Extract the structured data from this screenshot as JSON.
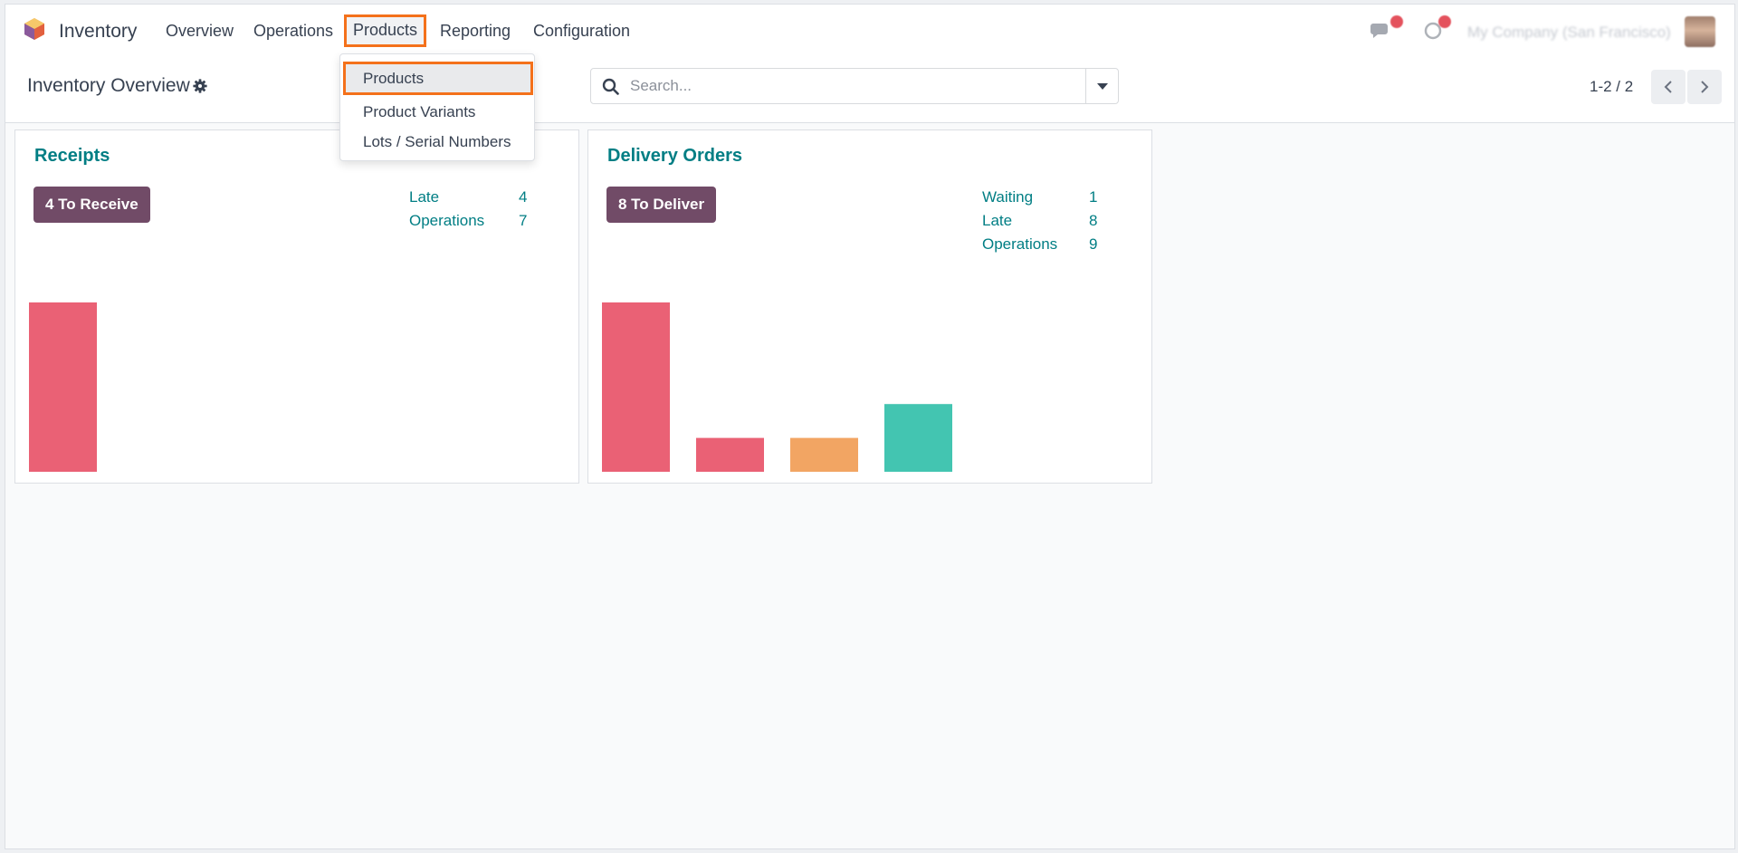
{
  "app": {
    "name": "Inventory"
  },
  "menu": {
    "items": [
      "Overview",
      "Operations",
      "Products",
      "Reporting",
      "Configuration"
    ]
  },
  "products_dropdown": {
    "items": [
      "Products",
      "Product Variants",
      "Lots / Serial Numbers"
    ]
  },
  "systray": {
    "company": "My Company (San Francisco)"
  },
  "control_panel": {
    "breadcrumb": "Inventory Overview",
    "search_placeholder": "Search...",
    "pager": "1-2 / 2"
  },
  "cards": [
    {
      "title": "Receipts",
      "button": "4 To Receive",
      "stats": [
        {
          "label": "Late",
          "value": "4"
        },
        {
          "label": "Operations",
          "value": "7"
        }
      ],
      "bars": [
        {
          "value": 5,
          "color": "#ea6175"
        }
      ]
    },
    {
      "title": "Delivery Orders",
      "button": "8 To Deliver",
      "stats": [
        {
          "label": "Waiting",
          "value": "1"
        },
        {
          "label": "Late",
          "value": "8"
        },
        {
          "label": "Operations",
          "value": "9"
        }
      ],
      "bars": [
        {
          "value": 5,
          "color": "#ea6175"
        },
        {
          "value": 1,
          "color": "#ea6175"
        },
        {
          "value": 1,
          "color": "#f2a563"
        },
        {
          "value": 2,
          "color": "#43c5b1"
        }
      ]
    }
  ],
  "colors": {
    "accent": "#714b67",
    "link": "#017e84",
    "highlight_outline": "#f4711b"
  }
}
